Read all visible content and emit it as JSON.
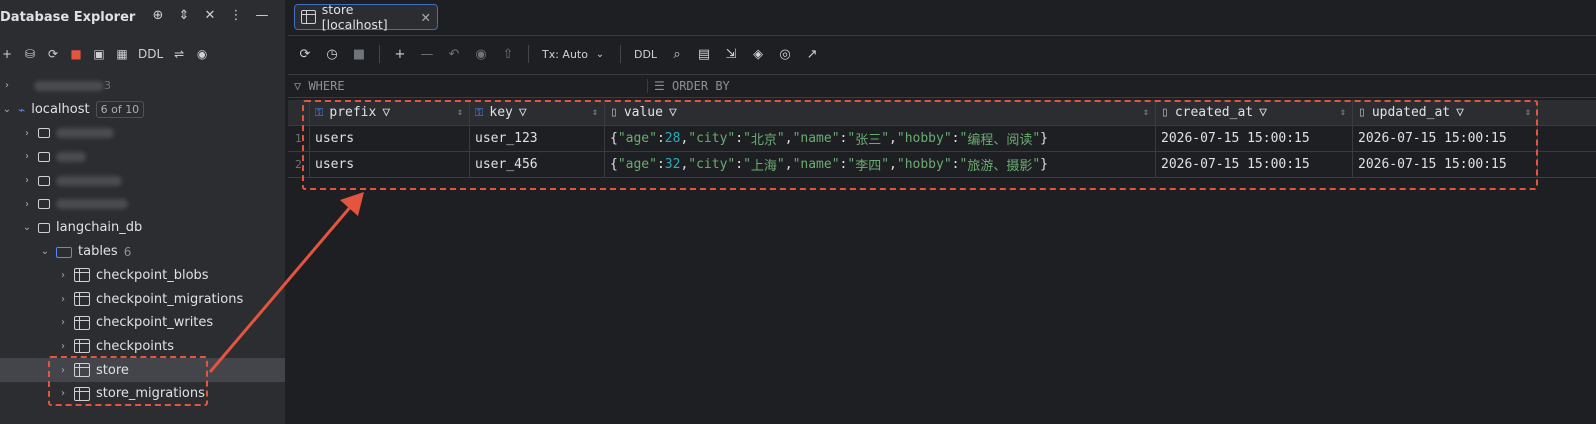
{
  "sidebar": {
    "title": "Database Explorer",
    "toolbar": {
      "ddl": "DDL"
    },
    "localhost": {
      "label": "localhost",
      "badge": "6 of 10",
      "first_badge_fragment": "3"
    },
    "langchain": {
      "label": "langchain_db"
    },
    "tables": {
      "label": "tables",
      "count": "6"
    },
    "items": [
      "checkpoint_blobs",
      "checkpoint_migrations",
      "checkpoint_writes",
      "checkpoints",
      "store",
      "store_migrations"
    ]
  },
  "tab": {
    "label": "store [localhost]"
  },
  "toolbar": {
    "tx": "Tx: Auto",
    "ddl": "DDL"
  },
  "filter": {
    "where": "WHERE",
    "order": "ORDER BY"
  },
  "grid": {
    "columns": [
      "prefix",
      "key",
      "value",
      "created_at",
      "updated_at"
    ],
    "rows": [
      {
        "num": "1",
        "prefix": "users",
        "key": "user_123",
        "created_at": "2026-07-15 15:00:15",
        "updated_at": "2026-07-15 15:00:15",
        "value": {
          "age": "28",
          "city": "北京",
          "name": "张三",
          "hobby": "编程、阅读"
        }
      },
      {
        "num": "2",
        "prefix": "users",
        "key": "user_456",
        "created_at": "2026-07-15 15:00:15",
        "updated_at": "2026-07-15 15:00:15",
        "value": {
          "age": "32",
          "city": "上海",
          "name": "李四",
          "hobby": "旅游、摄影"
        }
      }
    ]
  },
  "annotation_color": "#e4553f"
}
